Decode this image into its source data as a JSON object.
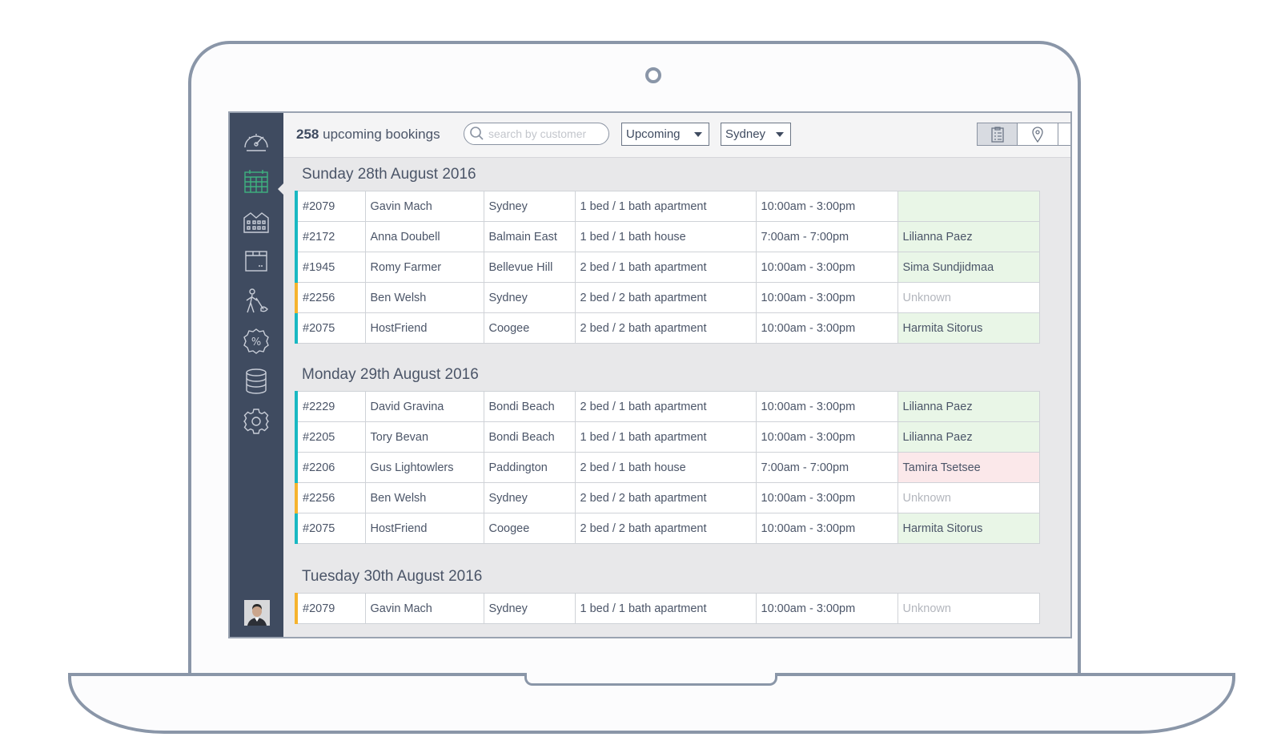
{
  "header": {
    "count": "258",
    "count_label": "upcoming bookings",
    "search_placeholder": "search by customer",
    "status_filter": "Upcoming",
    "city_filter": "Sydney"
  },
  "sidebar": {
    "items": [
      {
        "icon": "speedometer-icon"
      },
      {
        "icon": "calendar-icon",
        "active": true
      },
      {
        "icon": "buildings-icon"
      },
      {
        "icon": "inbox-icon"
      },
      {
        "icon": "cleaner-icon"
      },
      {
        "icon": "discount-icon"
      },
      {
        "icon": "database-icon"
      },
      {
        "icon": "settings-icon"
      }
    ]
  },
  "view_toggle": [
    "list-icon",
    "map-pin-icon",
    "clock-icon"
  ],
  "colors": {
    "sidebar": "#3f4b60",
    "accent_green": "#3fb27f",
    "stripe_teal": "#19b8c2",
    "stripe_orange": "#f5b32d",
    "assigned_bg": "#e9f6e7",
    "alert_bg": "#fbe8ea"
  },
  "days": [
    {
      "date": "Sunday 28th August 2016",
      "bookings": [
        {
          "id": "#2079",
          "customer": "Gavin Mach",
          "suburb": "Sydney",
          "property": "1 bed / 1 bath apartment",
          "time": "10:00am - 3:00pm",
          "cleaner": "",
          "stripe": "teal",
          "status": "assigned"
        },
        {
          "id": "#2172",
          "customer": "Anna Doubell",
          "suburb": "Balmain East",
          "property": "1 bed / 1 bath house",
          "time": "7:00am - 7:00pm",
          "cleaner": "Lilianna Paez",
          "stripe": "teal",
          "status": "assigned"
        },
        {
          "id": "#1945",
          "customer": "Romy Farmer",
          "suburb": "Bellevue Hill",
          "property": "2 bed / 1 bath apartment",
          "time": "10:00am - 3:00pm",
          "cleaner": "Sima Sundjidmaa",
          "stripe": "teal",
          "status": "assigned"
        },
        {
          "id": "#2256",
          "customer": "Ben Welsh",
          "suburb": "Sydney",
          "property": "2 bed / 2 bath apartment",
          "time": "10:00am - 3:00pm",
          "cleaner": "Unknown",
          "stripe": "orange",
          "status": "unknown"
        },
        {
          "id": "#2075",
          "customer": "HostFriend",
          "suburb": "Coogee",
          "property": "2 bed / 2 bath apartment",
          "time": "10:00am - 3:00pm",
          "cleaner": "Harmita Sitorus",
          "stripe": "teal",
          "status": "assigned"
        }
      ]
    },
    {
      "date": "Monday 29th August 2016",
      "bookings": [
        {
          "id": "#2229",
          "customer": "David Gravina",
          "suburb": "Bondi Beach",
          "property": "2 bed / 1 bath apartment",
          "time": "10:00am - 3:00pm",
          "cleaner": "Lilianna Paez",
          "stripe": "teal",
          "status": "assigned"
        },
        {
          "id": "#2205",
          "customer": "Tory Bevan",
          "suburb": "Bondi Beach",
          "property": "1 bed / 1 bath apartment",
          "time": "10:00am - 3:00pm",
          "cleaner": "Lilianna Paez",
          "stripe": "teal",
          "status": "assigned"
        },
        {
          "id": "#2206",
          "customer": "Gus Lightowlers",
          "suburb": "Paddington",
          "property": "2 bed / 1 bath house",
          "time": "7:00am - 7:00pm",
          "cleaner": "Tamira Tsetsee",
          "stripe": "teal",
          "status": "alert"
        },
        {
          "id": "#2256",
          "customer": "Ben Welsh",
          "suburb": "Sydney",
          "property": "2 bed / 2 bath apartment",
          "time": "10:00am - 3:00pm",
          "cleaner": "Unknown",
          "stripe": "orange",
          "status": "unknown"
        },
        {
          "id": "#2075",
          "customer": "HostFriend",
          "suburb": "Coogee",
          "property": "2 bed / 2 bath apartment",
          "time": "10:00am - 3:00pm",
          "cleaner": "Harmita Sitorus",
          "stripe": "teal",
          "status": "assigned"
        }
      ]
    },
    {
      "date": "Tuesday 30th August 2016",
      "bookings": [
        {
          "id": "#2079",
          "customer": "Gavin Mach",
          "suburb": "Sydney",
          "property": "1 bed / 1 bath apartment",
          "time": "10:00am - 3:00pm",
          "cleaner": "Unknown",
          "stripe": "orange",
          "status": "unknown"
        }
      ]
    }
  ]
}
